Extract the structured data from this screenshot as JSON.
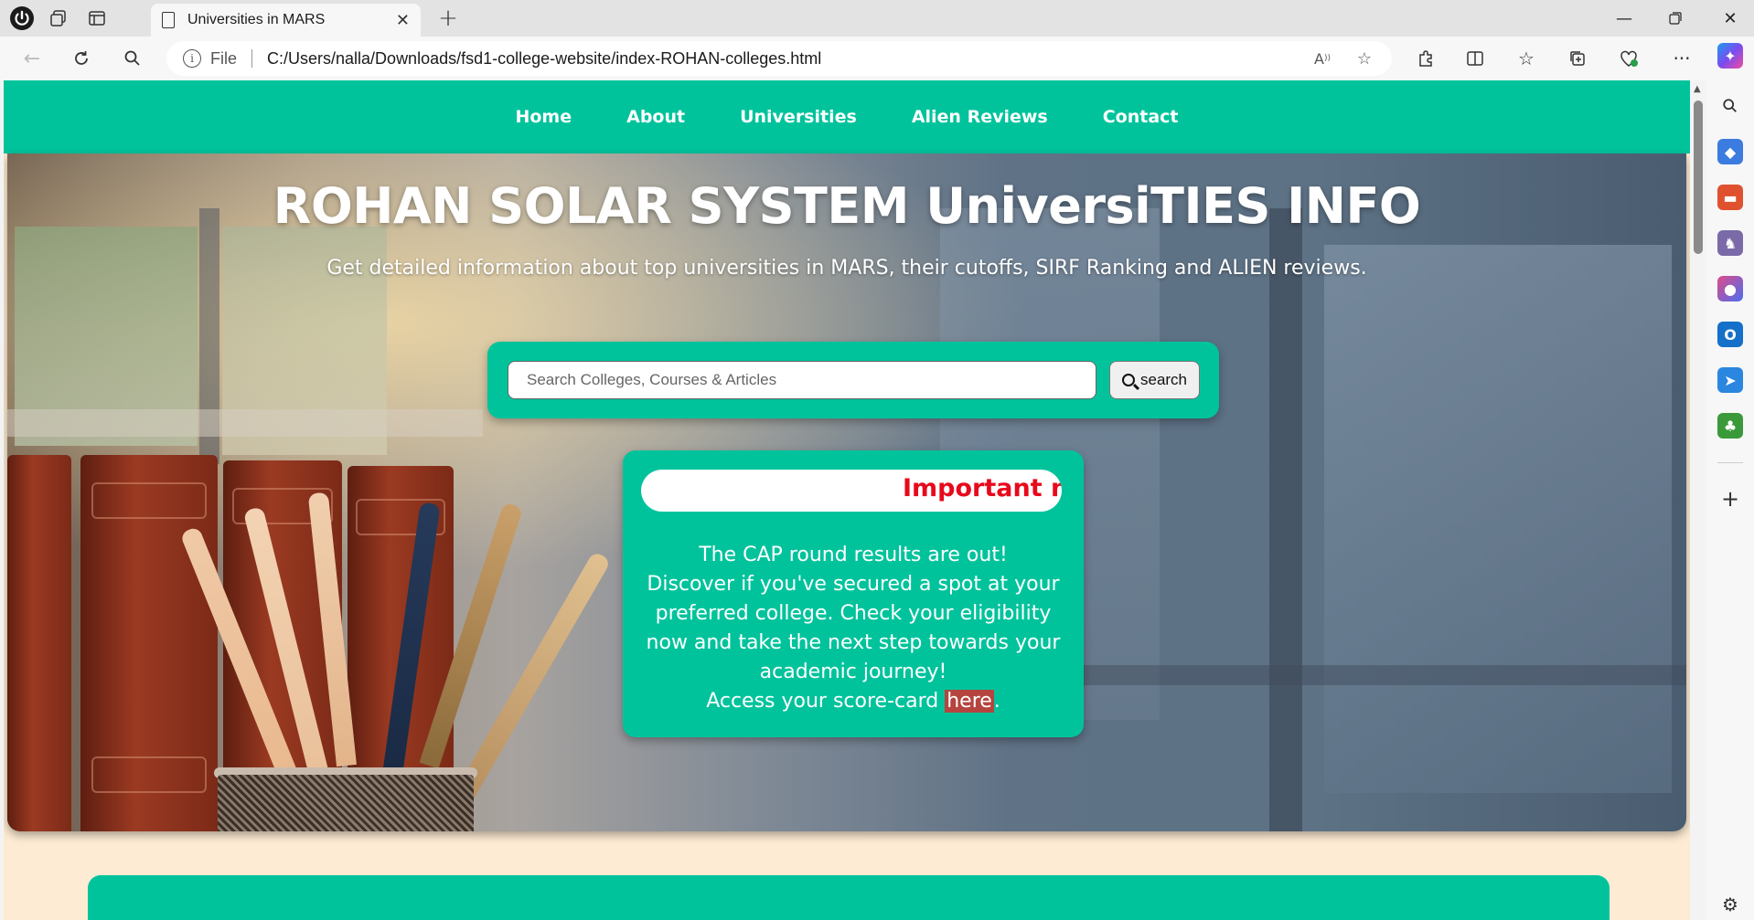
{
  "browser": {
    "tab_title": "Universities in MARS",
    "address_prefix": "File",
    "url": "C:/Users/nalla/Downloads/fsd1-college-website/index-ROHAN-colleges.html"
  },
  "nav": {
    "items": [
      {
        "label": "Home"
      },
      {
        "label": "About"
      },
      {
        "label": "Universities"
      },
      {
        "label": "Alien Reviews"
      },
      {
        "label": "Contact"
      }
    ]
  },
  "hero": {
    "title": "ROHAN SOLAR SYSTEM UniversiTIES INFO",
    "subtitle": "Get detailed information about top universities in MARS, their cutoffs, SIRF Ranking and ALIEN reviews."
  },
  "search": {
    "placeholder": "Search Colleges, Courses & Articles",
    "button_label": "search"
  },
  "notice": {
    "marquee_text": "Important notice",
    "line1": "The CAP round results are out!",
    "line2": "Discover if you've secured a spot at your preferred college. Check your eligibility now and take the next step towards your academic journey!",
    "line3_prefix": "Access your score-card ",
    "link_label": "here",
    "line3_suffix": "."
  },
  "colors": {
    "accent": "#00c39c",
    "page_bg": "#fdebd3",
    "notice_text": "#e8091c",
    "link_bg": "#b5443f"
  }
}
